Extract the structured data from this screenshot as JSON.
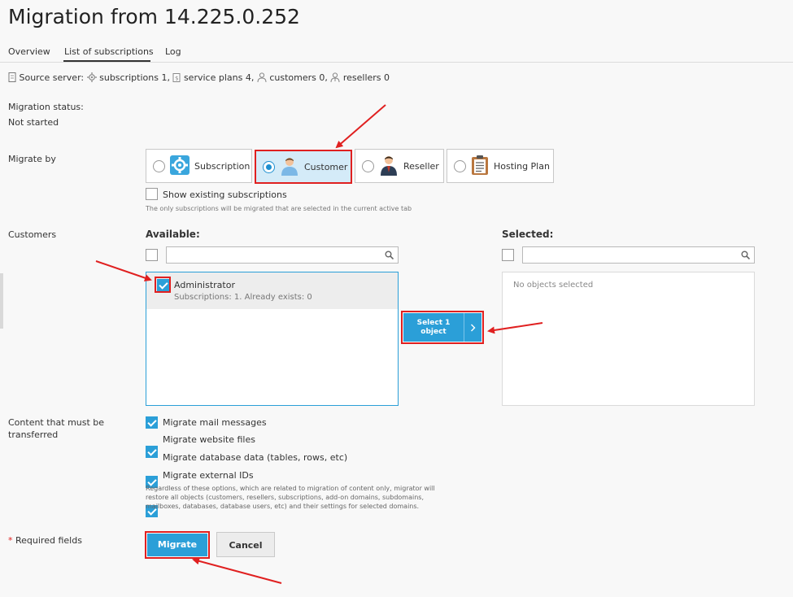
{
  "page": {
    "title": "Migration from 14.225.0.252"
  },
  "tabs": [
    {
      "label": "Overview",
      "active": false
    },
    {
      "label": "List of subscriptions",
      "active": true
    },
    {
      "label": "Log",
      "active": false
    }
  ],
  "source_server": {
    "label": "Source server:",
    "subscriptions": "subscriptions 1,",
    "service_plans": "service plans 4,",
    "customers": "customers 0,",
    "resellers": "resellers 0"
  },
  "migration_status": {
    "label": "Migration status:",
    "value": "Not started"
  },
  "migrate_by": {
    "label": "Migrate by",
    "options": [
      {
        "label": "Subscription",
        "icon": "gear-icon",
        "selected": false
      },
      {
        "label": "Customer",
        "icon": "customer-avatar-icon",
        "selected": true
      },
      {
        "label": "Reseller",
        "icon": "reseller-avatar-icon",
        "selected": false
      },
      {
        "label": "Hosting Plan",
        "icon": "clipboard-icon",
        "selected": false
      }
    ],
    "show_existing_label": "Show existing subscriptions",
    "show_existing_checked": false,
    "hint": "The only subscriptions will be migrated that are selected in the current active tab"
  },
  "customers": {
    "label": "Customers",
    "available_title": "Available:",
    "selected_title": "Selected:",
    "available_items": [
      {
        "name": "Administrator",
        "details": "Subscriptions: 1. Already exists: 0",
        "checked": true
      }
    ],
    "selected_empty": "No objects selected",
    "select_button": "Select 1 object",
    "select_button_line1": "Select 1",
    "select_button_line2": "object"
  },
  "content": {
    "label_line1": "Content that must be",
    "label_line2": "transferred",
    "options": [
      {
        "label": "Migrate mail messages",
        "checked": true
      },
      {
        "label": "Migrate website files",
        "checked": true
      },
      {
        "label": "Migrate database data (tables, rows, etc)",
        "checked": true
      },
      {
        "label": "Migrate external IDs",
        "checked": true
      }
    ],
    "note_line1": "Regardless of these options, which are related to migration of content only, migrator will",
    "note_line2": "restore all objects (customers, resellers, subscriptions, add-on domains, subdomains,",
    "note_line3": "mailboxes, databases, database users, etc) and their settings for selected domains."
  },
  "footer": {
    "required_star": "*",
    "required_label": "Required fields",
    "migrate_button": "Migrate",
    "cancel_button": "Cancel"
  },
  "colors": {
    "accent": "#2b9fd8",
    "selected_card_bg": "#d4ebf8",
    "highlight_red": "#e02020"
  }
}
